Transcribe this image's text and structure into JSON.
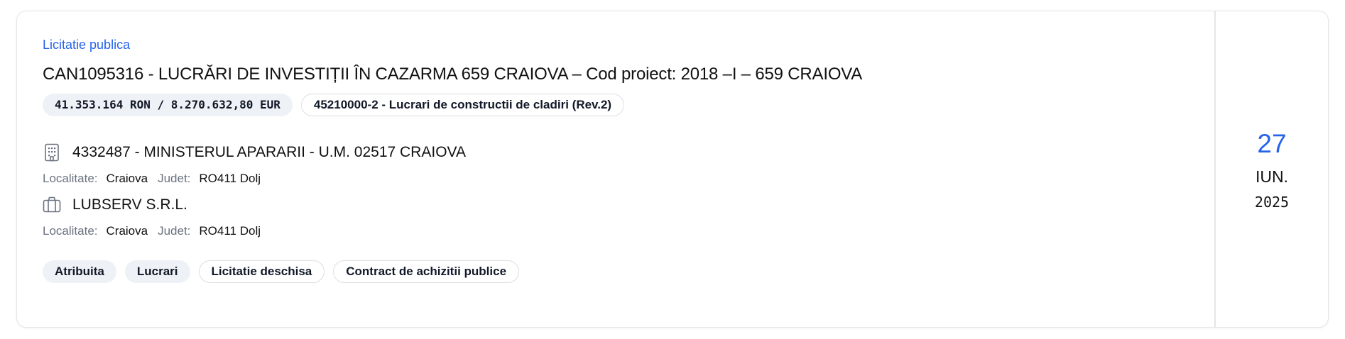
{
  "procedure_type": "Licitatie publica",
  "title": "CAN1095316 - LUCRĂRI DE INVESTIȚII ÎN CAZARMA 659 CRAIOVA – Cod proiect: 2018 –I – 659 CRAIOVA",
  "value_chip": "41.353.164 RON / 8.270.632,80 EUR",
  "cpv_chip": "45210000-2 - Lucrari de constructii de cladiri (Rev.2)",
  "authority": {
    "icon": "building-icon",
    "name": "4332487 - MINISTERUL APARARII - U.M. 02517 CRAIOVA",
    "locality_label": "Localitate:",
    "locality": "Craiova",
    "county_label": "Judet:",
    "county": "RO411 Dolj"
  },
  "supplier": {
    "icon": "briefcase-icon",
    "name": "LUBSERV S.R.L.",
    "locality_label": "Localitate:",
    "locality": "Craiova",
    "county_label": "Judet:",
    "county": "RO411 Dolj"
  },
  "tags": [
    {
      "label": "Atribuita",
      "style": "filled"
    },
    {
      "label": "Lucrari",
      "style": "filled"
    },
    {
      "label": "Licitatie deschisa",
      "style": "outlined"
    },
    {
      "label": "Contract de achizitii publice",
      "style": "outlined"
    }
  ],
  "date": {
    "day": "27",
    "month": "IUN.",
    "year": "2025"
  },
  "colors": {
    "accent": "#2563eb",
    "chip_fill": "#eef1f5",
    "border": "#e3e5e8",
    "muted_text": "#6b7280"
  }
}
